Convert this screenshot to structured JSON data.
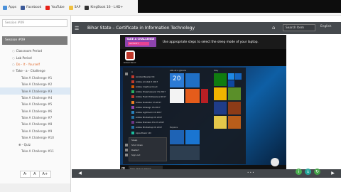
{
  "bookmarks": [
    {
      "label": "Apps",
      "color": "#4a90d9"
    },
    {
      "label": "Facebook",
      "color": "#3b5998"
    },
    {
      "label": "YouTube",
      "color": "#e62117"
    },
    {
      "label": "SAP",
      "color": "#f0c040"
    },
    {
      "label": "KingBook 16 - LHD+",
      "color": "#333333"
    }
  ],
  "sidebar": {
    "search_placeholder": "Session #09",
    "title": "Session #09",
    "items": [
      {
        "label": "Classroom Period",
        "level": 1,
        "marker": "○"
      },
      {
        "label": "Lab Period",
        "level": 1,
        "marker": "○"
      },
      {
        "label": "Do - It - Yourself",
        "level": 1,
        "marker": "○",
        "active": true
      },
      {
        "label": "Take - a - Challenge",
        "level": 1,
        "marker": "⊖"
      },
      {
        "label": "Take A Challenge #1",
        "level": 3
      },
      {
        "label": "Take A Challenge #2",
        "level": 3
      },
      {
        "label": "Take A Challenge #3",
        "level": 3,
        "selected": true
      },
      {
        "label": "Take A Challenge #4",
        "level": 3
      },
      {
        "label": "Take A Challenge #5",
        "level": 3
      },
      {
        "label": "Take A Challenge #6",
        "level": 3
      },
      {
        "label": "Take A Challenge #7",
        "level": 3
      },
      {
        "label": "Take A Challenge #8",
        "level": 3
      },
      {
        "label": "Take A Challenge #9",
        "level": 3
      },
      {
        "label": "Take A Challenge #10",
        "level": 3
      },
      {
        "label": "⊕ - Quiz",
        "level": 2
      },
      {
        "label": "Take A Challenge #11",
        "level": 3
      }
    ],
    "font_controls": [
      "A-",
      "A",
      "A+"
    ]
  },
  "header": {
    "title": "Bihar State – Certificate in Information Technology",
    "search_placeholder": "Search Item",
    "language": "English"
  },
  "screen": {
    "badge_line1": "TAKE A CHALLENGE",
    "badge_line2": "ACTIVITY",
    "instruction": "Use appropriate steps to select the sleep mode of your laptop.",
    "logo_label": "BIHAR BSCIT",
    "app_list_head": "A",
    "apps": [
      "Acrobat Reader DC",
      "Adobe Acrobat X 2017",
      "Adobe Creative Cloud",
      "Adobe Dreamweaver CS 2017",
      "Adobe Flash Professional 2017",
      "Adobe Illustrator CS 2017",
      "Adobe InDesign CS 2017",
      "Adobe Lightroom CS 2017",
      "Adobe Photoshop CS 2017",
      "Adobe Premiere Pro CS 2017",
      "Adobe Photoshop CS 2017",
      "Apps Power Ltd",
      "Autodesk Outlook"
    ],
    "power_menu": [
      "Sleep",
      "Shut down",
      "Restart",
      "Sign out"
    ],
    "tile_groups": [
      "Life at a glance",
      "Play",
      "Explore"
    ],
    "calendar_day": "20",
    "taskbar_search": "Type here to search"
  },
  "bottom": {
    "prev_label": "◀",
    "next_label": "▶",
    "dots": "• • •"
  },
  "colors": {
    "header_bg": "#45494d",
    "accent_orange": "#e06a2c",
    "selected_row": "#dde9f5",
    "icon_green": "#4caf50",
    "icon_teal": "#26a69a",
    "icon_red": "#e53935"
  }
}
